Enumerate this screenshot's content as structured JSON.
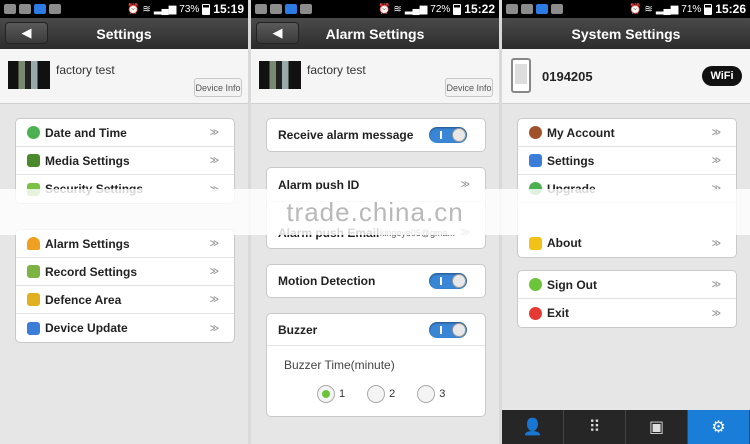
{
  "status_left": {
    "time": "15:19",
    "battery": "73%"
  },
  "status_mid": {
    "time": "15:22",
    "battery": "72%"
  },
  "status_right": {
    "time": "15:26",
    "battery": "71%"
  },
  "left": {
    "title": "Settings",
    "device_name": "factory test",
    "device_info_label": "Device Info",
    "menu1": [
      "Date and Time",
      "Media Settings",
      "Security Settings"
    ],
    "menu2": [
      "Alarm Settings",
      "Record Settings",
      "Defence Area",
      "Device Update"
    ]
  },
  "middle": {
    "title": "Alarm Settings",
    "device_name": "factory test",
    "device_info_label": "Device Info",
    "receive_alarm": "Receive alarm message",
    "alarm_push_id": "Alarm push ID",
    "alarm_push_email": "Alarm push Email",
    "alarm_push_email_value": "kingeye05@gma...",
    "motion_detection": "Motion Detection",
    "buzzer": "Buzzer",
    "buzzer_time": "Buzzer Time(minute)",
    "buzzer_options": [
      "1",
      "2",
      "3"
    ],
    "buzzer_selected": "1"
  },
  "right": {
    "title": "System Settings",
    "device_id": "0194205",
    "wifi_badge": "WiFi",
    "menu1": [
      "My Account",
      "Settings",
      "Upgrade",
      "About"
    ],
    "menu2": [
      "Sign Out",
      "Exit"
    ]
  },
  "chevron": "≫",
  "watermark": "trade.china.cn"
}
